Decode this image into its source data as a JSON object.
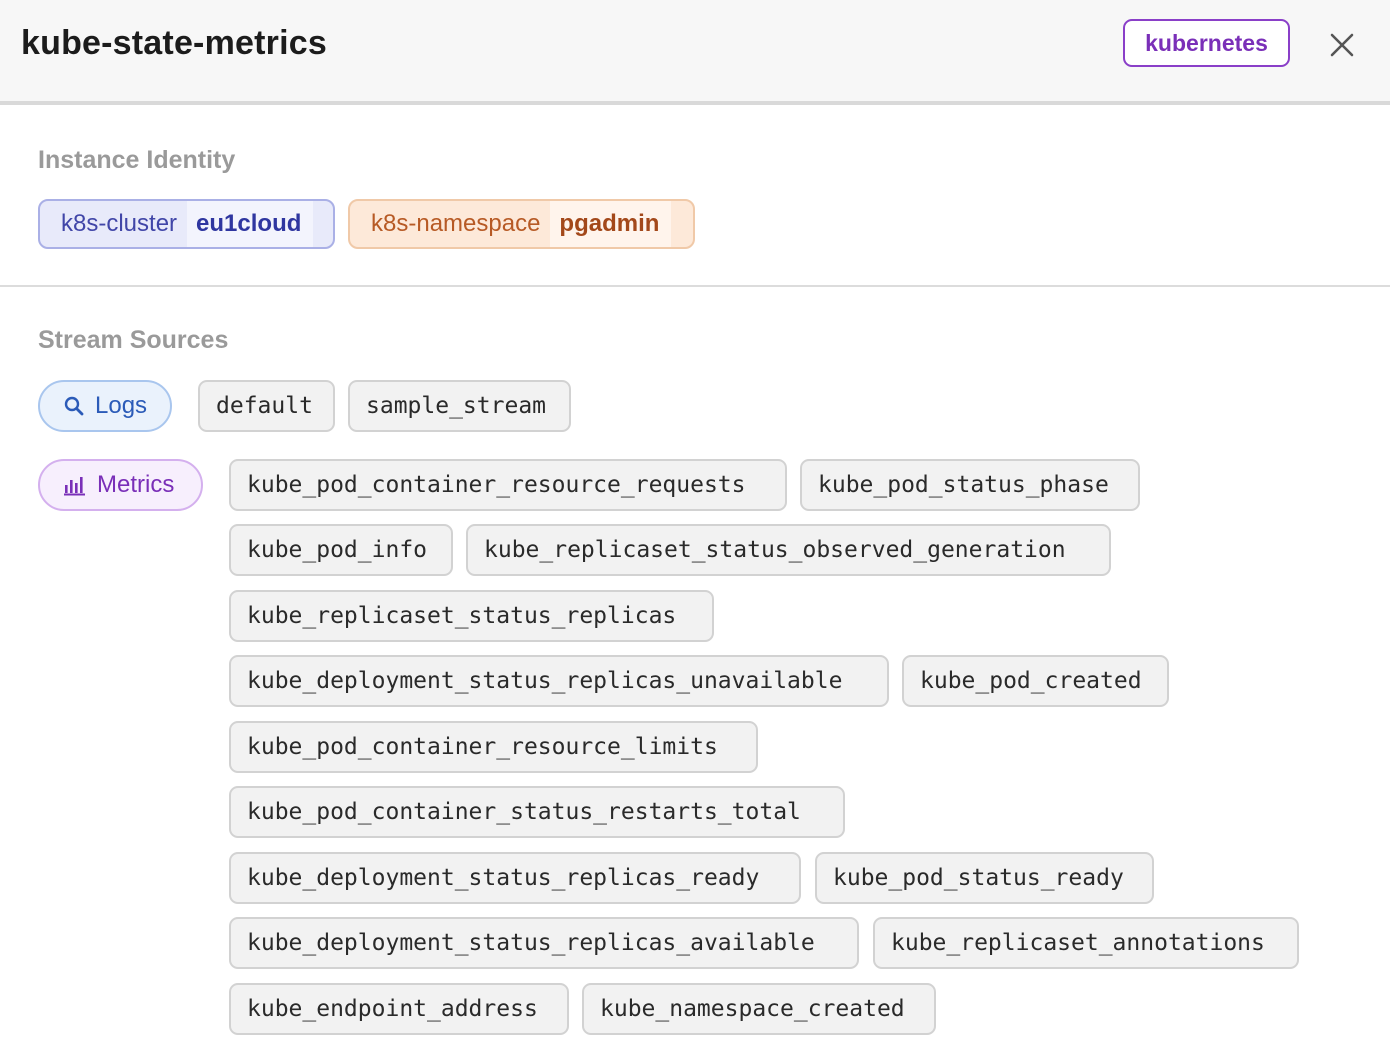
{
  "header": {
    "title": "kube-state-metrics",
    "type_badge": "kubernetes",
    "close_icon": "close-icon"
  },
  "instance_identity": {
    "title": "Instance Identity",
    "tags": [
      {
        "key": "k8s-cluster",
        "value": "eu1cloud",
        "color": "#e8eafa"
      },
      {
        "key": "k8s-namespace",
        "value": "pgadmin",
        "color": "#fde9d9"
      }
    ]
  },
  "stream_sources": {
    "title": "Stream Sources",
    "logs": {
      "label": "Logs",
      "icon": "search-icon",
      "streams": [
        "default",
        "sample_stream"
      ]
    },
    "metrics": {
      "label": "Metrics",
      "icon": "bar-chart-icon",
      "streams": [
        "kube_pod_container_resource_requests",
        "kube_pod_status_phase",
        "kube_pod_info",
        "kube_replicaset_status_observed_generation",
        "kube_replicaset_status_replicas",
        "kube_deployment_status_replicas_unavailable",
        "kube_pod_created",
        "kube_pod_container_resource_limits",
        "kube_pod_container_status_restarts_total",
        "kube_deployment_status_replicas_ready",
        "kube_pod_status_ready",
        "kube_deployment_status_replicas_available",
        "kube_replicaset_annotations",
        "kube_endpoint_address",
        "kube_namespace_created"
      ]
    }
  },
  "colors": {
    "accent_purple": "#7a2fb8",
    "logs_blue": "#2b5bb8",
    "section_gray": "#9a9a9a"
  }
}
